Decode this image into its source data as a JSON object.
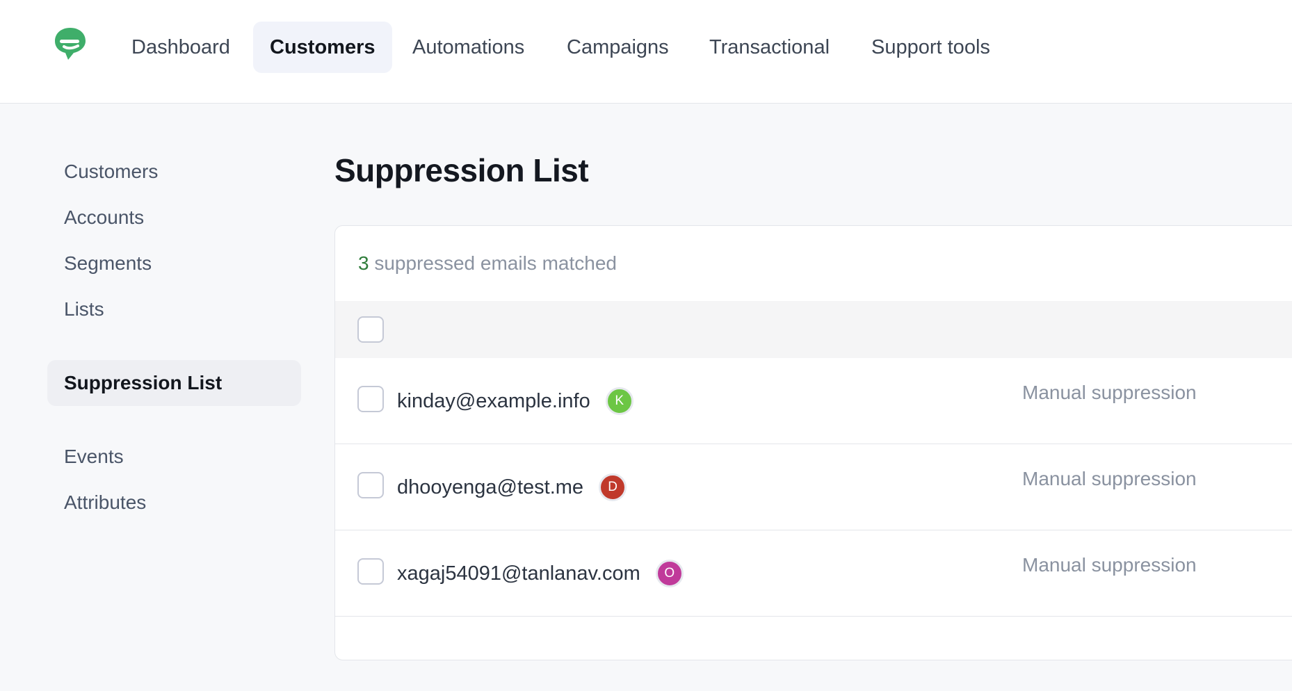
{
  "nav": {
    "items": [
      {
        "label": "Dashboard",
        "active": false
      },
      {
        "label": "Customers",
        "active": true
      },
      {
        "label": "Automations",
        "active": false
      },
      {
        "label": "Campaigns",
        "active": false
      },
      {
        "label": "Transactional",
        "active": false
      },
      {
        "label": "Support tools",
        "active": false
      }
    ]
  },
  "sidebar": {
    "items": [
      {
        "label": "Customers"
      },
      {
        "label": "Accounts"
      },
      {
        "label": "Segments"
      },
      {
        "label": "Lists"
      },
      {
        "label": "Suppression List",
        "active": true
      },
      {
        "label": "Events"
      },
      {
        "label": "Attributes"
      }
    ]
  },
  "main": {
    "title": "Suppression List",
    "count": "3",
    "count_suffix": "suppressed emails matched",
    "rows": [
      {
        "email": "kinday@example.info",
        "initial": "K",
        "avatar_color": "#6cc644",
        "reason": "Manual suppression"
      },
      {
        "email": "dhooyenga@test.me",
        "initial": "D",
        "avatar_color": "#c0392b",
        "reason": "Manual suppression"
      },
      {
        "email": "xagaj54091@tanlanav.com",
        "initial": "O",
        "avatar_color": "#c03a9a",
        "reason": "Manual suppression"
      }
    ]
  },
  "colors": {
    "brand": "#3fae6a",
    "count_number": "#2f7d3b"
  }
}
